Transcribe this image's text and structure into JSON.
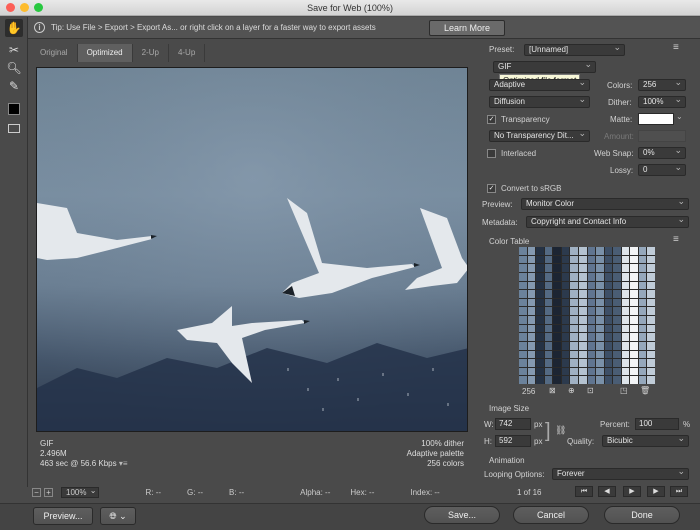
{
  "window": {
    "title": "Save for Web (100%)"
  },
  "tip": {
    "text": "Tip: Use File > Export > Export As... or right click on a layer for a faster way to export assets",
    "learn_more": "Learn More"
  },
  "tabs": [
    "Original",
    "Optimized",
    "2-Up",
    "4-Up"
  ],
  "preview_info": {
    "format": "GIF",
    "size": "2.496M",
    "speed": "463 sec @ 56.6 Kbps",
    "dither": "100% dither",
    "palette": "Adaptive palette",
    "colors": "256 colors"
  },
  "statusbar": {
    "zoom": "100%",
    "r": "R: --",
    "g": "G: --",
    "b": "B: --",
    "alpha": "Alpha: --",
    "hex": "Hex: --",
    "index": "Index: --"
  },
  "panel": {
    "preset_label": "Preset:",
    "preset_value": "[Unnamed]",
    "format_value": "GIF",
    "tooltip": "Optimized file format",
    "reduction_value": "Adaptive",
    "colors_label": "Colors:",
    "colors_value": "256",
    "dither_algo": "Diffusion",
    "dither_label": "Dither:",
    "dither_value": "100%",
    "transparency_label": "Transparency",
    "matte_label": "Matte:",
    "transparency_dither": "No Transparency Dit...",
    "amount_label": "Amount:",
    "interlaced_label": "Interlaced",
    "websnap_label": "Web Snap:",
    "websnap_value": "0%",
    "lossy_label": "Lossy:",
    "lossy_value": "0",
    "convert_label": "Convert to sRGB",
    "preview_label": "Preview:",
    "preview_value": "Monitor Color",
    "metadata_label": "Metadata:",
    "metadata_value": "Copyright and Contact Info",
    "color_table_label": "Color Table",
    "color_count": "256",
    "image_size_label": "Image Size",
    "w_label": "W:",
    "w_value": "742",
    "h_label": "H:",
    "h_value": "592",
    "px": "px",
    "percent_label": "Percent:",
    "percent_value": "100",
    "percent_sign": "%",
    "quality_label": "Quality:",
    "quality_value": "Bicubic",
    "animation_label": "Animation",
    "looping_label": "Looping Options:",
    "looping_value": "Forever",
    "frame_counter": "1 of 16"
  },
  "bottom": {
    "preview": "Preview...",
    "save": "Save...",
    "cancel": "Cancel",
    "done": "Done"
  },
  "colors": {
    "matte": "#ffffff",
    "accent_close": "#fc5f57",
    "accent_min": "#fdbc2e",
    "accent_max": "#28c840"
  }
}
